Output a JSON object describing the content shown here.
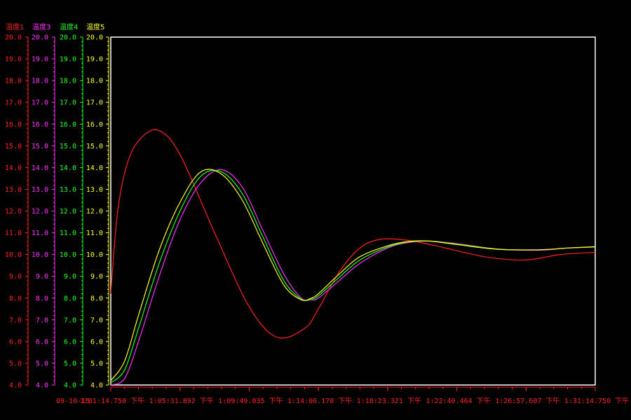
{
  "chart_data": {
    "type": "line",
    "title": "",
    "date_label": "09-10-15",
    "x_tick_labels": [
      "1:01:14.750 下午",
      "1:05:31.892 下午",
      "1:09:49.035 下午",
      "1:14:06.178 下午",
      "1:18:23.321 下午",
      "1:22:40.464 下午",
      "1:26:57.607 下午",
      "1:31:14.750 下午"
    ],
    "y_ticks": [
      "4.0",
      "5.0",
      "6.0",
      "7.0",
      "8.0",
      "9.0",
      "10.0",
      "11.0",
      "12.0",
      "13.0",
      "14.0",
      "15.0",
      "16.0",
      "17.0",
      "18.0",
      "19.0",
      "20.0"
    ],
    "ylim": [
      4,
      20
    ],
    "x_count": 8,
    "grid": false,
    "series": [
      {
        "name": "温度1",
        "color": "#ff2020",
        "x": [
          0,
          0.1,
          0.25,
          0.45,
          0.7,
          1,
          1.5,
          2,
          2.4,
          2.8,
          3,
          3.3,
          3.6,
          3.9,
          4.3,
          4.7,
          5.1,
          5.5,
          6,
          6.5,
          7
        ],
        "y": [
          8.2,
          12.0,
          14.3,
          15.4,
          15.7,
          14.6,
          11.0,
          7.6,
          6.2,
          6.6,
          7.5,
          9.2,
          10.3,
          10.7,
          10.65,
          10.4,
          10.1,
          9.85,
          9.75,
          10.0,
          10.1
        ]
      },
      {
        "name": "温度3",
        "color": "#ff30ff",
        "x": [
          0,
          0.2,
          0.4,
          0.7,
          1,
          1.3,
          1.6,
          1.9,
          2.2,
          2.5,
          2.75,
          2.9,
          3,
          3.3,
          3.6,
          4,
          4.3,
          4.6,
          5,
          5.6,
          6.2,
          6.6,
          7
        ],
        "y": [
          4.0,
          4.3,
          6.0,
          9.0,
          11.6,
          13.3,
          13.9,
          13.1,
          11.1,
          9.1,
          8.0,
          7.92,
          8.0,
          8.8,
          9.6,
          10.3,
          10.55,
          10.62,
          10.5,
          10.25,
          10.2,
          10.3,
          10.35
        ]
      },
      {
        "name": "温度4",
        "color": "#20ff20",
        "x": [
          0,
          0.2,
          0.4,
          0.7,
          1,
          1.3,
          1.6,
          1.9,
          2.2,
          2.5,
          2.75,
          2.9,
          3,
          3.3,
          3.6,
          4,
          4.3,
          4.6,
          5,
          5.6,
          6.2,
          6.6,
          7
        ],
        "y": [
          4.1,
          4.7,
          6.6,
          9.6,
          12.0,
          13.6,
          13.8,
          12.8,
          10.8,
          8.8,
          7.95,
          7.95,
          8.1,
          8.95,
          9.75,
          10.35,
          10.58,
          10.62,
          10.48,
          10.25,
          10.22,
          10.3,
          10.35
        ]
      },
      {
        "name": "温度5",
        "color": "#ffff20",
        "x": [
          0,
          0.2,
          0.4,
          0.7,
          1,
          1.3,
          1.6,
          1.9,
          2.2,
          2.5,
          2.75,
          2.9,
          3,
          3.3,
          3.6,
          4,
          4.3,
          4.6,
          5,
          5.6,
          6.2,
          6.6,
          7
        ],
        "y": [
          4.2,
          5.1,
          7.2,
          10.2,
          12.4,
          13.8,
          13.7,
          12.5,
          10.5,
          8.6,
          7.92,
          8.0,
          8.2,
          9.1,
          9.9,
          10.4,
          10.6,
          10.62,
          10.46,
          10.24,
          10.22,
          10.3,
          10.36
        ]
      }
    ]
  }
}
